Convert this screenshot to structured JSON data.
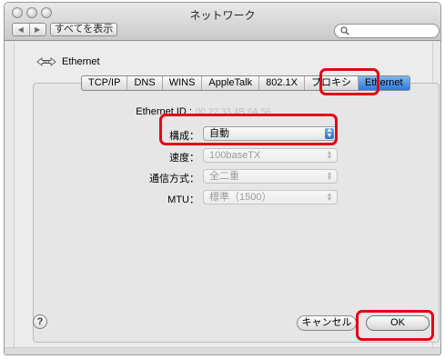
{
  "window": {
    "title": "ネットワーク"
  },
  "toolbar": {
    "show_all_label": "すべてを表示",
    "back_icon": "chevron-left-icon",
    "forward_icon": "chevron-right-icon"
  },
  "search": {
    "placeholder": ""
  },
  "sheet": {
    "service_name": "Ethernet",
    "tabs": [
      "TCP/IP",
      "DNS",
      "WINS",
      "AppleTalk",
      "802.1X",
      "プロキシ",
      "Ethernet"
    ],
    "active_tab": "Ethernet",
    "ethernet_id_label": "Ethernet ID :",
    "fields": {
      "config": {
        "label": "構成：",
        "value": "自動"
      },
      "speed": {
        "label": "速度：",
        "value": "100baseTX"
      },
      "duplex": {
        "label": "通信方式：",
        "value": "全二重"
      },
      "mtu": {
        "label": "MTU：",
        "value": "標準（1500）"
      }
    },
    "help_label": "?",
    "cancel_label": "キャンセル",
    "ok_label": "OK"
  },
  "highlight_color": "#e30613",
  "tab_active_color": "#2e7ad9"
}
